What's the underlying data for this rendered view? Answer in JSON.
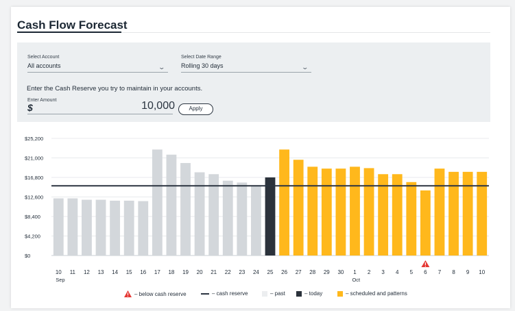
{
  "page": {
    "title": "Cash Flow Forecast"
  },
  "filters": {
    "account_label": "Select Account",
    "account_value": "All accounts",
    "range_label": "Select Date Range",
    "range_value": "Rolling 30 days",
    "reserve_prompt": "Enter the Cash Reserve you try to maintain in your accounts.",
    "amount_label": "Enter Amount",
    "currency_symbol": "$",
    "amount_value": "10,000",
    "apply_label": "Apply",
    "chevron_icon": "chevron-down-icon"
  },
  "colors": {
    "past": "#d3d7db",
    "today": "#2b323b",
    "scheduled": "#ffb81c",
    "reserve_line": "#2b3440",
    "warning": "#e53935"
  },
  "chart_data": {
    "type": "bar",
    "ylim": [
      0,
      25200
    ],
    "y_ticks": [
      "$0",
      "$4,200",
      "$8,400",
      "$12,600",
      "$16,800",
      "$21,000",
      "$25,200"
    ],
    "y_tick_values": [
      0,
      4200,
      8400,
      12600,
      16800,
      21000,
      25200
    ],
    "categories": [
      "10",
      "11",
      "12",
      "13",
      "14",
      "15",
      "16",
      "17",
      "18",
      "19",
      "20",
      "21",
      "22",
      "23",
      "24",
      "25",
      "26",
      "27",
      "28",
      "29",
      "30",
      "1",
      "2",
      "3",
      "4",
      "5",
      "6",
      "7",
      "8",
      "9",
      "10"
    ],
    "month_labels": [
      {
        "index": 0,
        "label": "Sep"
      },
      {
        "index": 21,
        "label": "Oct"
      }
    ],
    "values": [
      12300,
      12300,
      12000,
      12000,
      11800,
      11800,
      11700,
      22800,
      21700,
      19900,
      17900,
      17500,
      16100,
      15700,
      15100,
      16800,
      22800,
      20600,
      19100,
      18700,
      18700,
      19100,
      18800,
      17500,
      17500,
      15800,
      14000,
      18700,
      18000,
      18000,
      18000
    ],
    "kinds": [
      "past",
      "past",
      "past",
      "past",
      "past",
      "past",
      "past",
      "past",
      "past",
      "past",
      "past",
      "past",
      "past",
      "past",
      "past",
      "today",
      "scheduled",
      "scheduled",
      "scheduled",
      "scheduled",
      "scheduled",
      "scheduled",
      "scheduled",
      "scheduled",
      "scheduled",
      "scheduled",
      "scheduled",
      "scheduled",
      "scheduled",
      "scheduled",
      "scheduled"
    ],
    "cash_reserve": 15000,
    "warnings": [
      26
    ],
    "grid": true
  },
  "legend": {
    "below": "– below cash reserve",
    "reserve": "– cash reserve",
    "past": "– past",
    "today": "– today",
    "scheduled": "– scheduled and patterns"
  }
}
